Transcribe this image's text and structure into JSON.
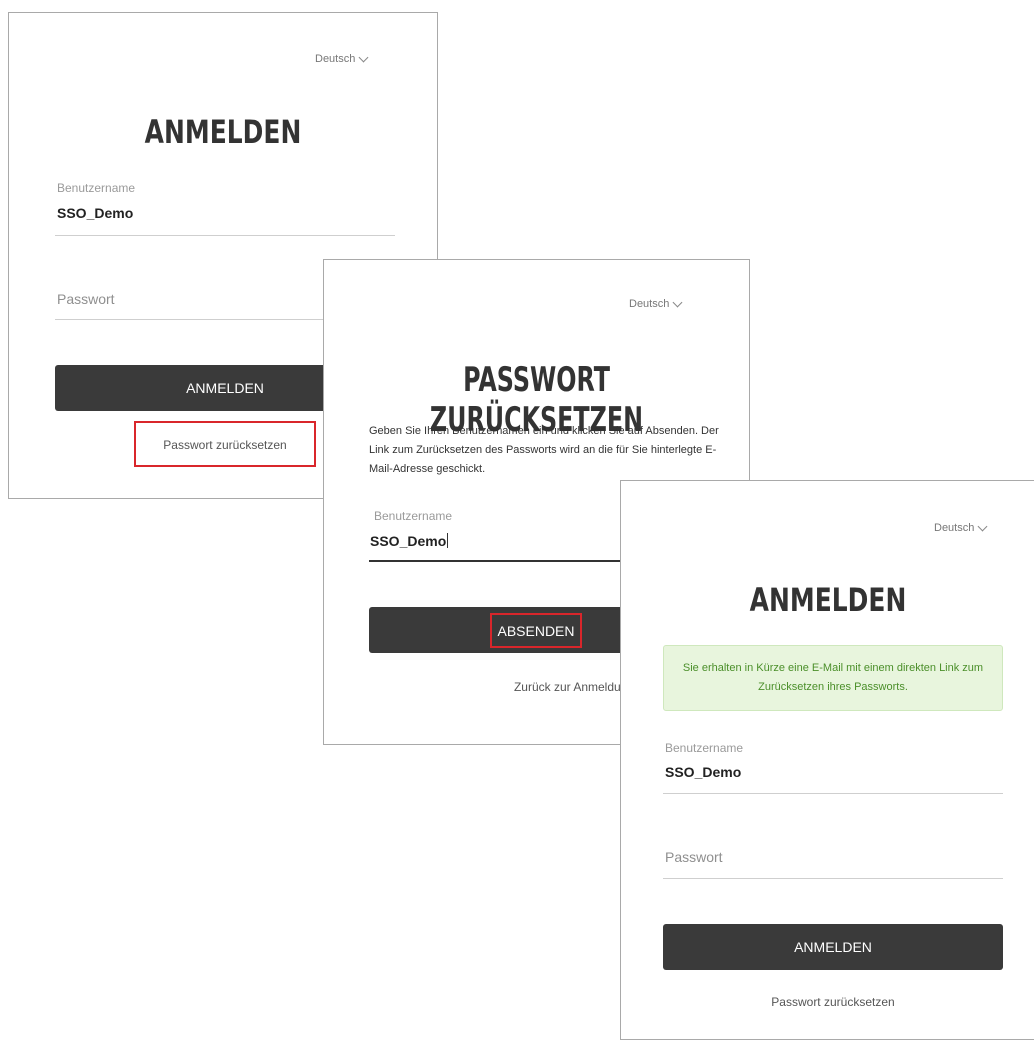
{
  "login_panel": {
    "language": "Deutsch",
    "title": "ANMELDEN",
    "username_label": "Benutzername",
    "username_value": "SSO_Demo",
    "password_placeholder": "Passwort",
    "submit_label": "ANMELDEN",
    "reset_link": "Passwort zurücksetzen"
  },
  "reset_panel": {
    "language": "Deutsch",
    "title": "PASSWORT ZURÜCKSETZEN",
    "description": "Geben Sie Ihren Benutzernamen ein und klicken Sie auf Absenden. Der Link zum Zurücksetzen des Passworts wird an die für Sie hinterlegte E-Mail-Adresse geschickt.",
    "username_label": "Benutzername",
    "username_value": "SSO_Demo",
    "submit_label": "ABSENDEN",
    "back_link": "Zurück zur Anmeldung"
  },
  "confirm_panel": {
    "language": "Deutsch",
    "title": "ANMELDEN",
    "success_message": "Sie erhalten in Kürze eine E-Mail mit einem direkten Link zum Zurücksetzen ihres Passworts.",
    "username_label": "Benutzername",
    "username_value": "SSO_Demo",
    "password_placeholder": "Passwort",
    "submit_label": "ANMELDEN",
    "reset_link": "Passwort zurücksetzen"
  },
  "colors": {
    "highlight": "#d9262b",
    "button": "#3a3a3a",
    "success_bg": "#e8f5dd",
    "success_text": "#4b8f2a"
  }
}
